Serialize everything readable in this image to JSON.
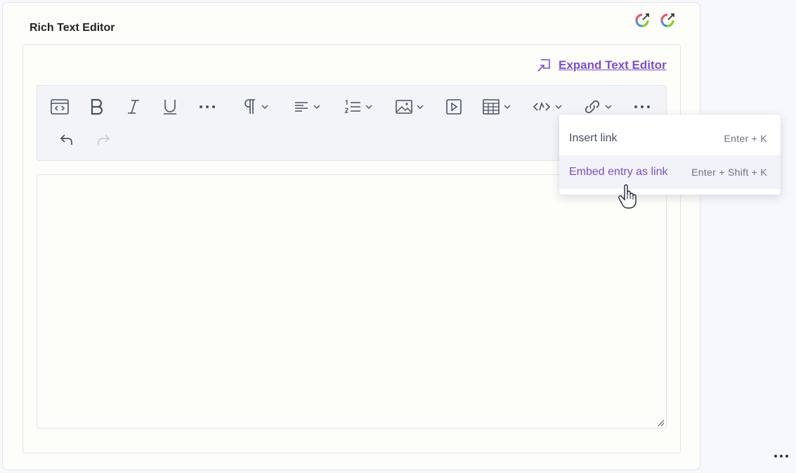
{
  "field": {
    "title": "Rich Text Editor"
  },
  "plugins": [
    {
      "icon": "plugin-magic-icon"
    },
    {
      "icon": "plugin-magic-icon"
    }
  ],
  "editor": {
    "expand_label": "Expand Text Editor",
    "toolbar": [
      {
        "name": "source-code",
        "icon": "source-code-icon"
      },
      {
        "name": "bold",
        "icon": "bold-icon"
      },
      {
        "name": "italic",
        "icon": "italic-icon"
      },
      {
        "name": "underline",
        "icon": "underline-icon"
      },
      {
        "name": "more-formatting",
        "icon": "ellipsis-icon"
      },
      {
        "name": "paragraph",
        "icon": "paragraph-icon"
      },
      {
        "name": "alignment",
        "icon": "align-left-icon"
      },
      {
        "name": "ordered-list",
        "icon": "ordered-list-icon"
      },
      {
        "name": "image",
        "icon": "image-icon"
      },
      {
        "name": "video",
        "icon": "video-icon"
      },
      {
        "name": "table",
        "icon": "table-icon"
      },
      {
        "name": "embed",
        "icon": "embed-icon"
      },
      {
        "name": "link",
        "icon": "link-icon"
      },
      {
        "name": "more",
        "icon": "ellipsis-icon"
      },
      {
        "name": "undo",
        "icon": "undo-icon"
      },
      {
        "name": "redo",
        "icon": "redo-icon"
      }
    ]
  },
  "link_menu": {
    "items": [
      {
        "label": "Insert link",
        "shortcut": "Enter + K"
      },
      {
        "label": "Embed entry as link",
        "shortcut": "Enter + Shift + K"
      }
    ]
  },
  "colors": {
    "accent": "#7c4dcc",
    "icon": "#475161",
    "border": "#e3e5ec"
  }
}
